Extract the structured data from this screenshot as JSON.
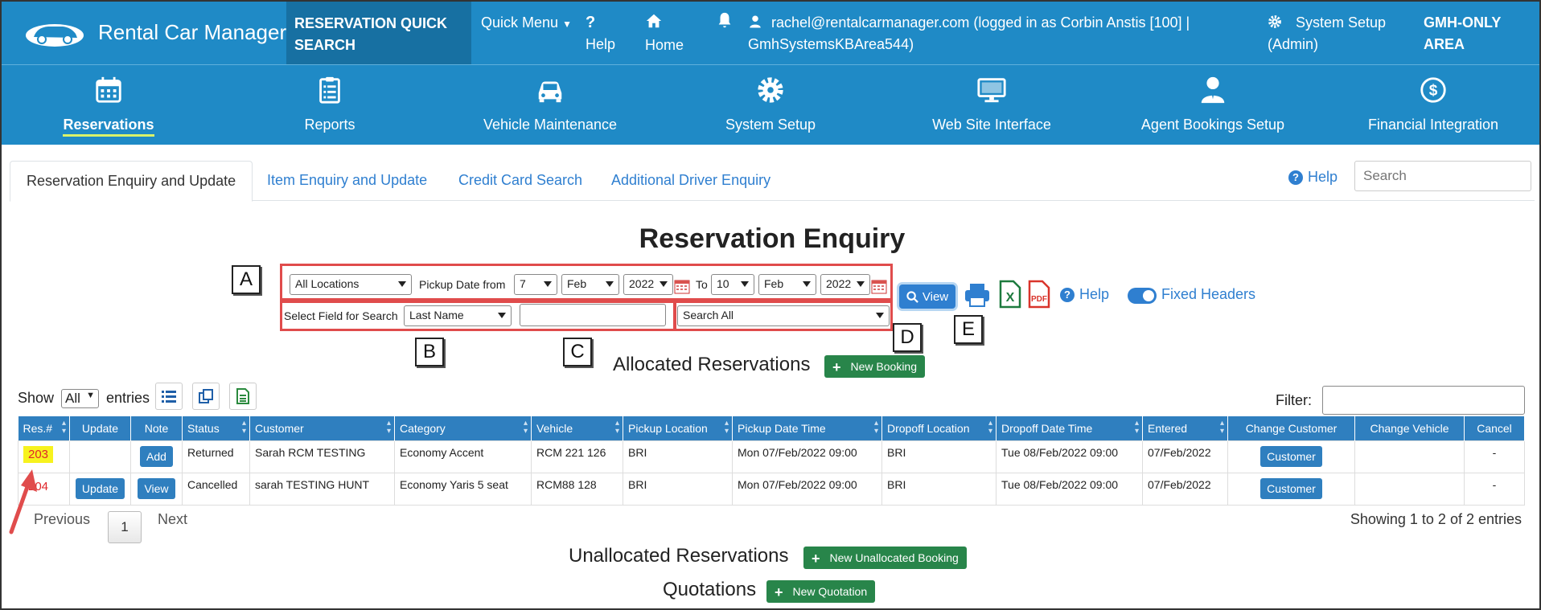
{
  "topbar": {
    "brand": "Rental Car Manager",
    "quick_search_line1": "RESERVATION QUICK",
    "quick_search_line2": "SEARCH",
    "quick_menu": "Quick Menu",
    "help": "Help",
    "home": "Home",
    "user_line1": "rachel@rentalcarmanager.com (logged in as Corbin Anstis [100] |",
    "user_line2": "GmhSystemsKBArea544)",
    "system_setup_line1": "System Setup",
    "system_setup_line2": "(Admin)",
    "area_line1": "GMH-ONLY",
    "area_line2": "AREA"
  },
  "modules": [
    {
      "label": "Reservations",
      "icon": "calendar-icon"
    },
    {
      "label": "Reports",
      "icon": "clipboard-icon"
    },
    {
      "label": "Vehicle Maintenance",
      "icon": "car-icon"
    },
    {
      "label": "System Setup",
      "icon": "gear-icon"
    },
    {
      "label": "Web Site Interface",
      "icon": "monitor-icon"
    },
    {
      "label": "Agent Bookings Setup",
      "icon": "agent-icon"
    },
    {
      "label": "Financial Integration",
      "icon": "dollar-icon"
    }
  ],
  "tabs": [
    "Reservation Enquiry and Update",
    "Item Enquiry and Update",
    "Credit Card Search",
    "Additional Driver Enquiry"
  ],
  "help_link": "Help",
  "search_placeholder": "Search",
  "page_title": "Reservation Enquiry",
  "filters": {
    "location": "All Locations",
    "pickup_from_label": "Pickup Date from",
    "from_day": "7",
    "from_month": "Feb",
    "from_year": "2022",
    "to_label": "To",
    "to_day": "10",
    "to_month": "Feb",
    "to_year": "2022",
    "select_field_label": "Select Field for Search",
    "field": "Last Name",
    "search_value": "",
    "search_scope": "Search All"
  },
  "callouts": {
    "a": "A",
    "b": "B",
    "c": "C",
    "d": "D",
    "e": "E"
  },
  "toolbar": {
    "view": "View",
    "help": "Help",
    "fixed_headers": "Fixed Headers"
  },
  "allocated": {
    "title": "Allocated Reservations",
    "new_button": "New Booking"
  },
  "show": {
    "prefix": "Show",
    "value": "All",
    "suffix": "entries"
  },
  "filter_label": "Filter:",
  "table": {
    "headers": [
      "Res.#",
      "Update",
      "Note",
      "Status",
      "Customer",
      "Category",
      "Vehicle",
      "Pickup Location",
      "Pickup Date Time",
      "Dropoff Location",
      "Dropoff Date Time",
      "Entered",
      "Change Customer",
      "Change Vehicle",
      "Cancel"
    ],
    "rows": [
      {
        "res": "203",
        "update": "",
        "note": "Add",
        "status": "Returned",
        "customer": "Sarah RCM TESTING",
        "category": "Economy Accent",
        "vehicle": "RCM 221 126",
        "pickup_loc": "BRI",
        "pickup_dt": "Mon 07/Feb/2022 09:00",
        "dropoff_loc": "BRI",
        "dropoff_dt": "Tue 08/Feb/2022 09:00",
        "entered": "07/Feb/2022",
        "change_customer": "Customer",
        "change_vehicle": "",
        "cancel": "-"
      },
      {
        "res": "204",
        "update": "Update",
        "note": "View",
        "status": "Cancelled",
        "customer": "sarah TESTING HUNT",
        "category": "Economy Yaris 5 seat",
        "vehicle": "RCM88 128",
        "pickup_loc": "BRI",
        "pickup_dt": "Mon 07/Feb/2022 09:00",
        "dropoff_loc": "BRI",
        "dropoff_dt": "Tue 08/Feb/2022 09:00",
        "entered": "07/Feb/2022",
        "change_customer": "Customer",
        "change_vehicle": "",
        "cancel": "-"
      }
    ]
  },
  "pagination": {
    "previous": "Previous",
    "page": "1",
    "next": "Next",
    "showing": "Showing 1 to 2 of 2 entries"
  },
  "unallocated": {
    "title": "Unallocated Reservations",
    "new_button": "New Unallocated Booking"
  },
  "quotations": {
    "title": "Quotations",
    "new_button": "New Quotation"
  },
  "colors": {
    "brand_blue": "#1f8ac6",
    "table_header": "#2f7fbf",
    "green": "#28854a",
    "annotation_red": "#e04c4c",
    "highlight_yellow": "#f7f21e"
  }
}
